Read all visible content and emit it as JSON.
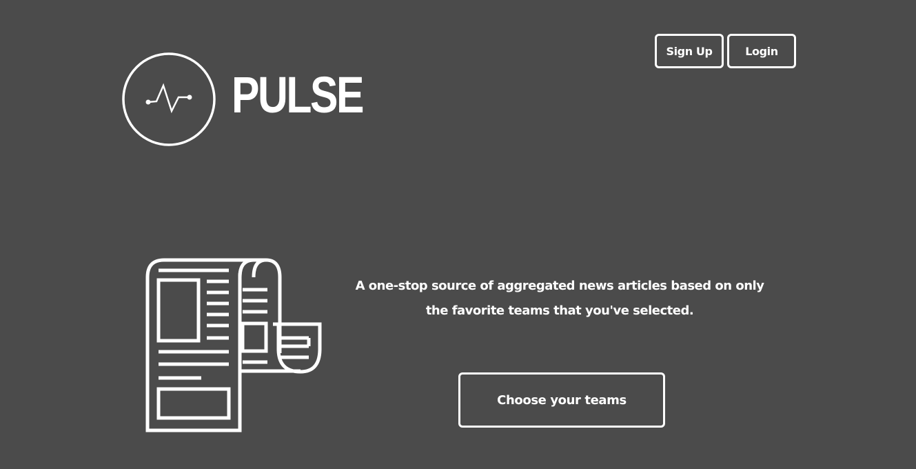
{
  "header": {
    "signup_label": "Sign Up",
    "login_label": "Login"
  },
  "brand": {
    "name": "PULSE",
    "logo_icon": "pulse-heartbeat-icon"
  },
  "hero": {
    "illustration_icon": "newspaper-icon",
    "tagline": "A one-stop source of aggregated news articles based on only the favorite teams that you've selected.",
    "cta_label": "Choose your teams"
  },
  "colors": {
    "background": "#4b4b4b",
    "foreground": "#ffffff"
  }
}
